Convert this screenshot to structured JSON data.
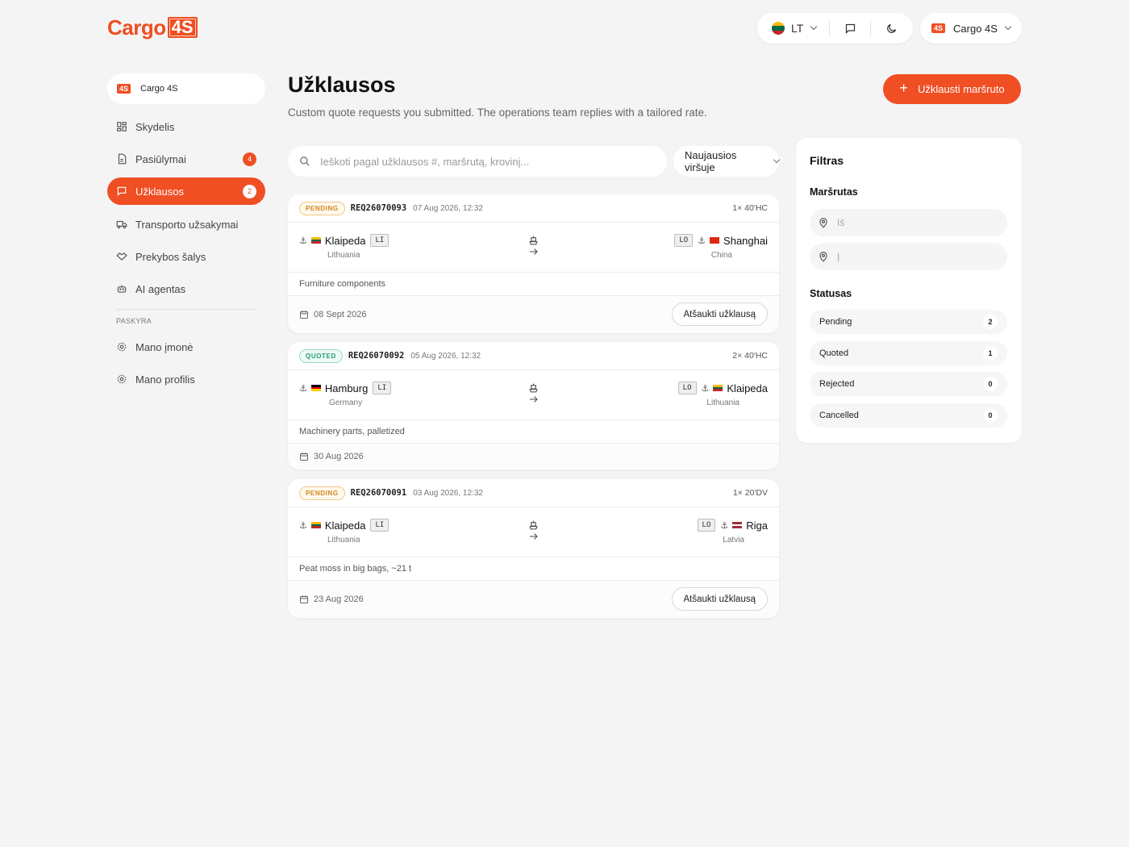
{
  "header": {
    "logo_word": "Cargo",
    "logo_badge": "4S",
    "language": "LT",
    "account_badge": "4S",
    "account_name": "Cargo 4S"
  },
  "sidebar": {
    "company_badge": "4S",
    "company_name": "Cargo 4S",
    "items": [
      {
        "label": "Skydelis",
        "icon": "dashboard-icon"
      },
      {
        "label": "Pasiūlymai",
        "icon": "document-icon",
        "badge": "4"
      },
      {
        "label": "Užklausos",
        "icon": "chat-icon",
        "badge": "2",
        "active": true
      },
      {
        "label": "Transporto užsakymai",
        "icon": "truck-icon"
      },
      {
        "label": "Prekybos šalys",
        "icon": "handshake-icon"
      },
      {
        "label": "AI agentas",
        "icon": "robot-icon"
      }
    ],
    "section_label": "PASKYRA",
    "account_items": [
      {
        "label": "Mano įmonė",
        "icon": "gear-icon"
      },
      {
        "label": "Mano profilis",
        "icon": "gear-icon"
      }
    ]
  },
  "page": {
    "title": "Užklausos",
    "subtitle": "Custom quote requests you submitted. The operations team replies with a tailored rate.",
    "primary_button": "Užklausti maršruto",
    "search_placeholder": "Ieškoti pagal užklausos #, maršrutą, krovinį...",
    "sort_label": "Naujausios viršuje"
  },
  "requests": [
    {
      "status": "PENDING",
      "id": "REQ26070093",
      "created": "07 Aug 2026, 12:32",
      "container": "1× 40'HC",
      "from": {
        "city": "Klaipeda",
        "country": "Lithuania",
        "code": "LI"
      },
      "to": {
        "city": "Shanghai",
        "country": "China",
        "code": "LO"
      },
      "cargo": "Furniture components",
      "date": "08 Sept 2026",
      "action": "Atšaukti užklausą"
    },
    {
      "status": "QUOTED",
      "id": "REQ26070092",
      "created": "05 Aug 2026, 12:32",
      "container": "2× 40'HC",
      "from": {
        "city": "Hamburg",
        "country": "Germany",
        "code": "LI"
      },
      "to": {
        "city": "Klaipeda",
        "country": "Lithuania",
        "code": "LO"
      },
      "cargo": "Machinery parts, palletized",
      "date": "30 Aug 2026"
    },
    {
      "status": "PENDING",
      "id": "REQ26070091",
      "created": "03 Aug 2026, 12:32",
      "container": "1× 20'DV",
      "from": {
        "city": "Klaipeda",
        "country": "Lithuania",
        "code": "LI"
      },
      "to": {
        "city": "Riga",
        "country": "Latvia",
        "code": "LO"
      },
      "cargo": "Peat moss in big bags, ~21 t",
      "date": "23 Aug 2026",
      "action": "Atšaukti užklausą"
    }
  ],
  "filter": {
    "title": "Filtras",
    "route_label": "Maršrutas",
    "from_placeholder": "Iš",
    "to_placeholder": "Į",
    "status_label": "Statusas",
    "statuses": [
      {
        "name": "Pending",
        "count": "2"
      },
      {
        "name": "Quoted",
        "count": "1"
      },
      {
        "name": "Rejected",
        "count": "0"
      },
      {
        "name": "Cancelled",
        "count": "0"
      }
    ]
  },
  "colors": {
    "brand": "#f04e23",
    "pending": "#d4861e",
    "quoted": "#1e9d72"
  }
}
